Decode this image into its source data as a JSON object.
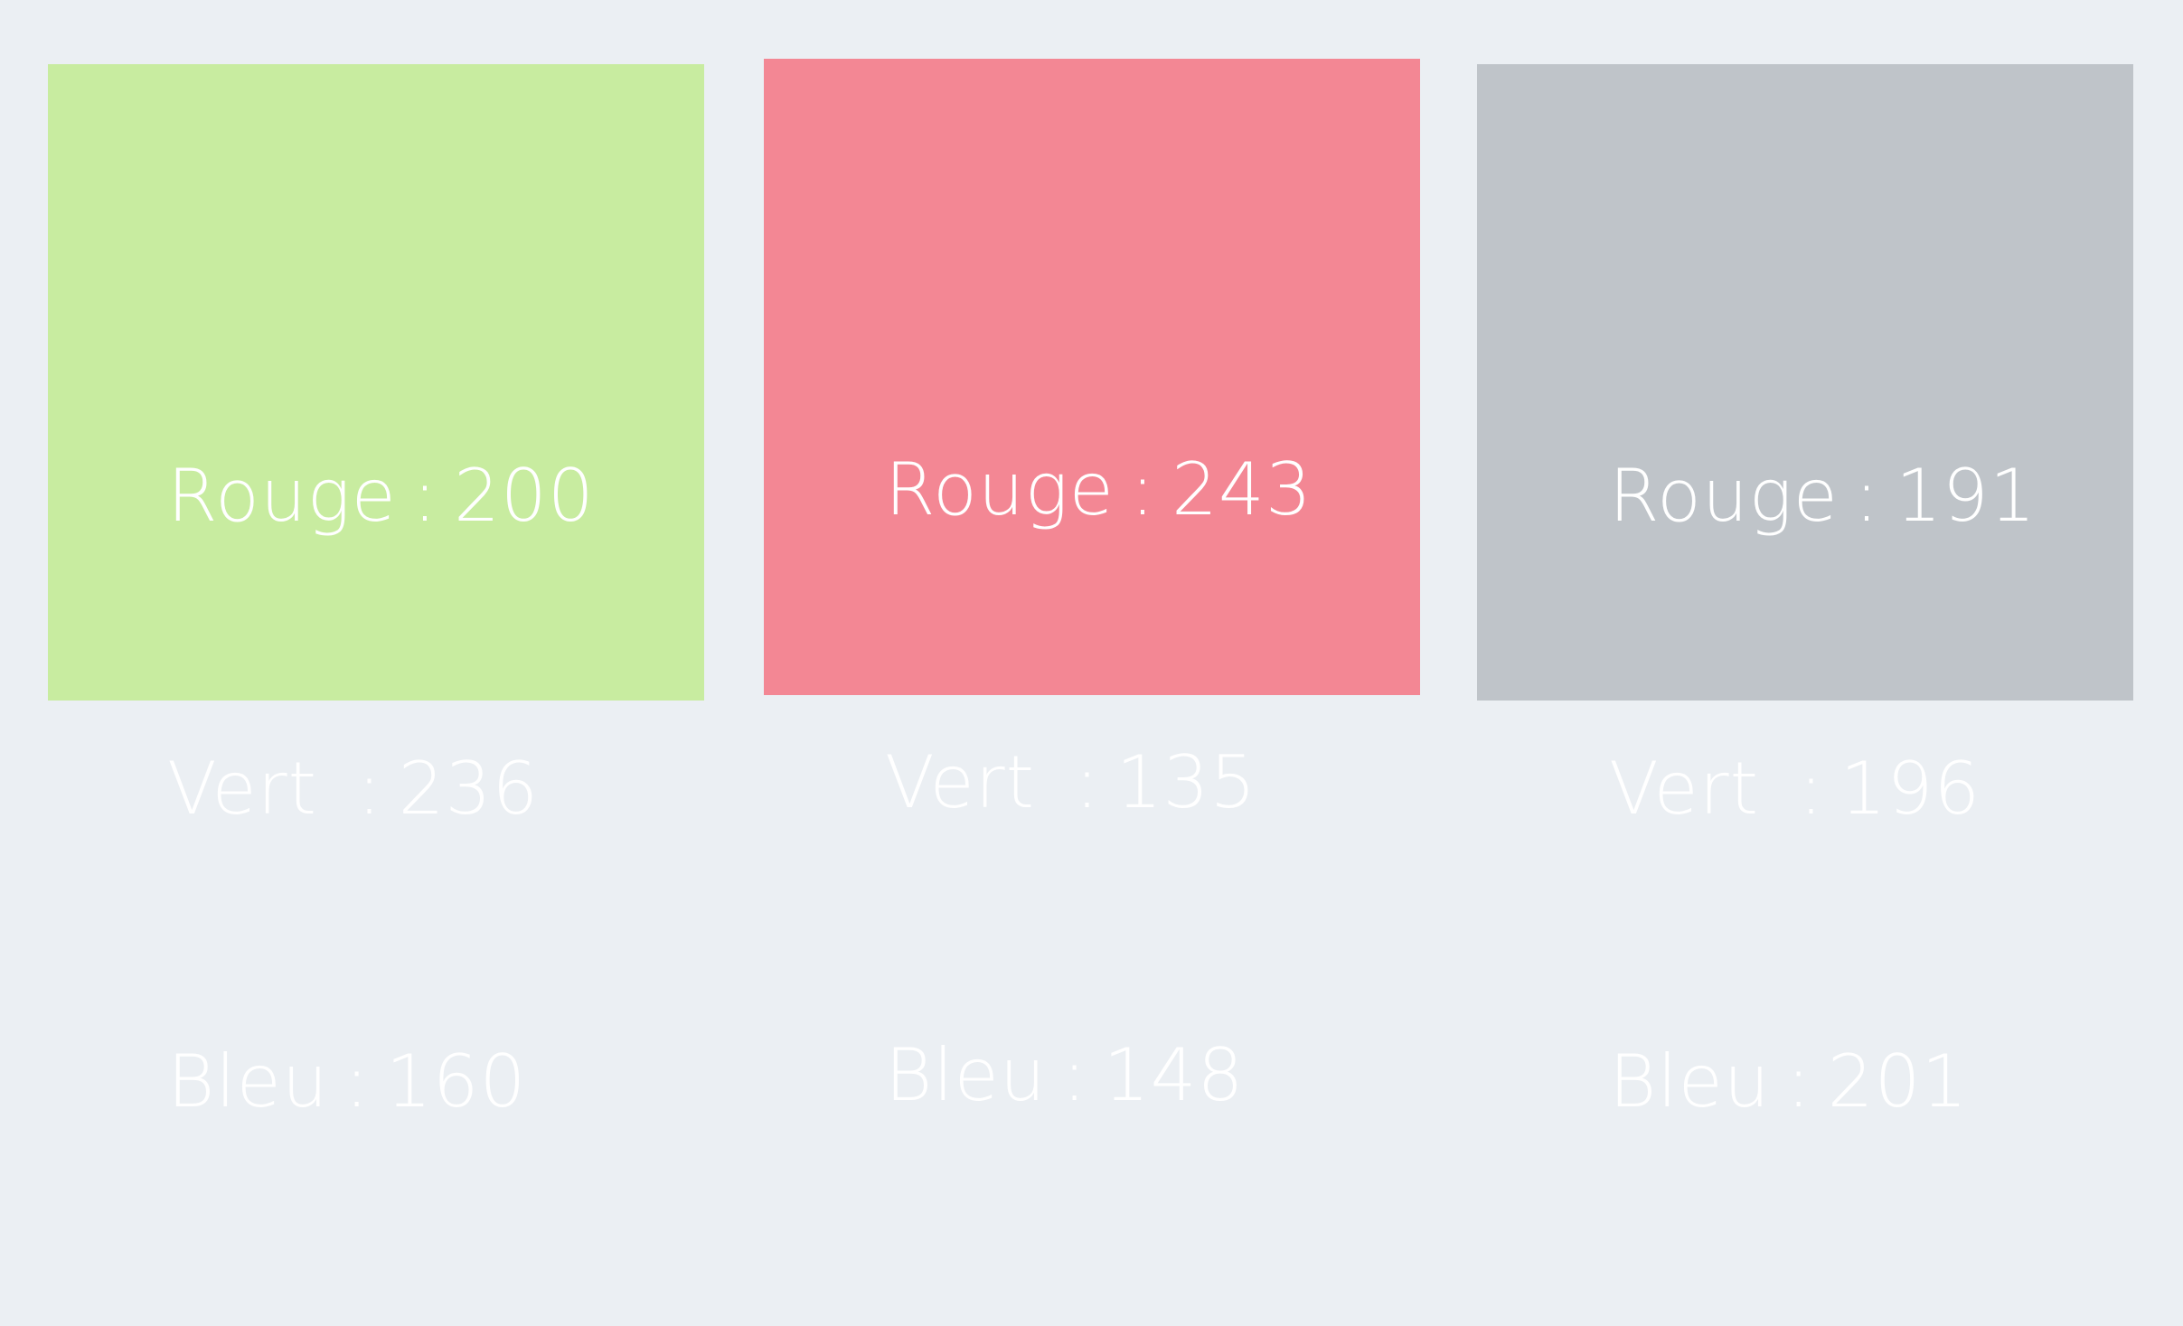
{
  "background_color": "#ebeff3",
  "text_color": "#ffffff",
  "swatches": [
    {
      "color": "#c8ecA0",
      "rows": [
        {
          "label": "Rouge",
          "sep": ":",
          "value": "200"
        },
        {
          "label": "Vert ",
          "sep": ":",
          "value": "236"
        },
        {
          "label": "Bleu",
          "sep": ":",
          "value": "160"
        }
      ]
    },
    {
      "color": "#f38794",
      "rows": [
        {
          "label": "Rouge",
          "sep": ":",
          "value": "243"
        },
        {
          "label": "Vert ",
          "sep": ":",
          "value": "135"
        },
        {
          "label": "Bleu",
          "sep": ":",
          "value": "148"
        }
      ]
    },
    {
      "color": "#bfc4c9",
      "rows": [
        {
          "label": "Rouge",
          "sep": ":",
          "value": "191"
        },
        {
          "label": "Vert ",
          "sep": ":",
          "value": "196"
        },
        {
          "label": "Bleu",
          "sep": ":",
          "value": "201"
        }
      ]
    }
  ]
}
